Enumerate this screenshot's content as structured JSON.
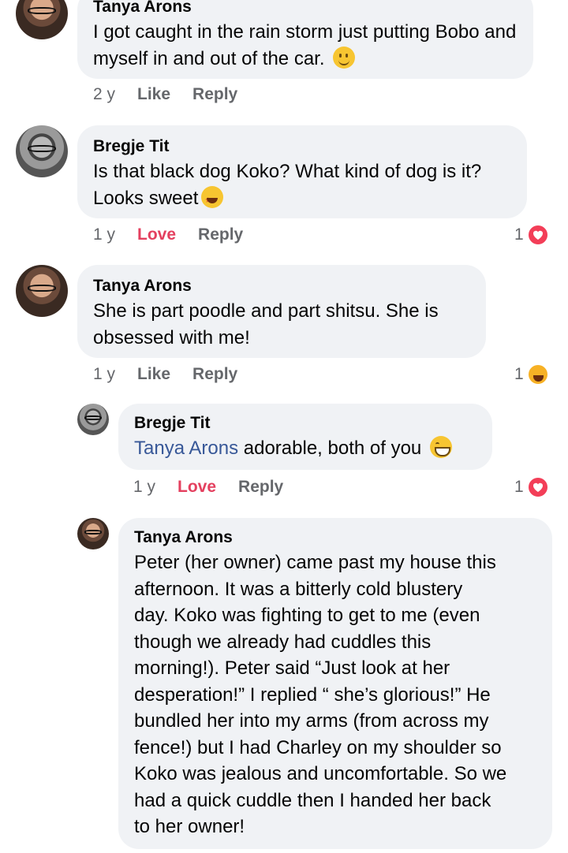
{
  "comments": [
    {
      "author": "Tanya Arons",
      "text": "I got caught in the rain storm just putting Bobo and myself in and out of the car.",
      "emoji": "slightly-smiling-face-emoji",
      "time": "2 y",
      "reaction_action": "Like",
      "reply": "Reply"
    },
    {
      "author": "Bregje Tit",
      "text": "Is that black dog Koko? What kind of dog is it? Looks sweet",
      "emoji": "star-struck-emoji",
      "time": "1 y",
      "reaction_action": "Love",
      "reply": "Reply",
      "reaction_count": "1",
      "reaction_icon": "heart-icon"
    },
    {
      "author": "Tanya Arons",
      "text": "She is part poodle and part shitsu.  She is obsessed with me!",
      "time": "1 y",
      "reaction_action": "Like",
      "reply": "Reply",
      "reaction_count": "1",
      "reaction_icon": "haha-icon"
    },
    {
      "author": "Bregje Tit",
      "mention": "Tanya Arons",
      "text": " adorable, both of you",
      "emoji": "grinning-face-emoji",
      "time": "1 y",
      "reaction_action": "Love",
      "reply": "Reply",
      "reaction_count": "1",
      "reaction_icon": "heart-icon"
    },
    {
      "author": "Tanya Arons",
      "lines": [
        "Peter (her owner) came past my house this",
        "afternoon.  It was a bitterly cold blustery",
        "day.  Koko was fighting to get to me (even",
        "though we already had cuddles this",
        "morning!). Peter said “Just look at her",
        "desperation!” I replied “ she’s glorious!”  He",
        "bundled her into my arms (from across my",
        "fence!) but I had Charley on my shoulder so",
        "Koko was jealous and uncomfortable.  So we",
        "had a quick cuddle then I handed her back",
        "to her owner!"
      ]
    }
  ],
  "colors": {
    "bubble": "#f0f2f5",
    "meta": "#65676b",
    "love": "#e4405f",
    "mention": "#385898"
  }
}
